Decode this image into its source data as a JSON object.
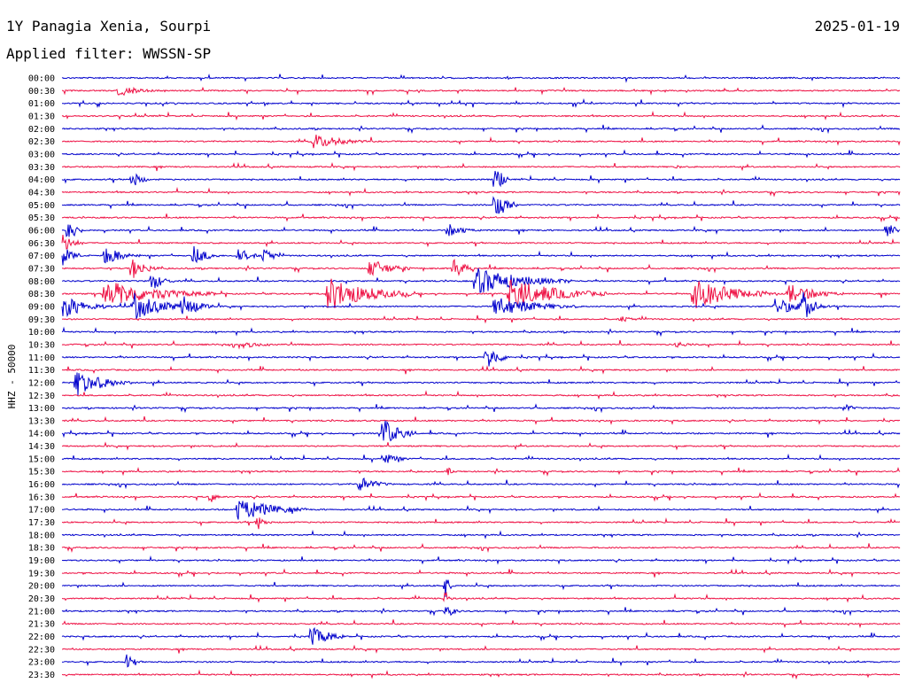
{
  "header": {
    "station": "1Y Panagia Xenia, Sourpi",
    "date": "2025-01-19",
    "filter_label": "Applied filter: WWSSN-SP"
  },
  "colors": {
    "blue": "#0000cc",
    "red": "#ee1144"
  },
  "chart_data": {
    "type": "line",
    "title": "1Y Panagia Xenia, Sourpi",
    "ylabel": "HHZ - 50000",
    "rows": [
      "00:00",
      "00:30",
      "01:00",
      "01:30",
      "02:00",
      "02:30",
      "03:00",
      "03:30",
      "04:00",
      "04:30",
      "05:00",
      "05:30",
      "06:00",
      "06:30",
      "07:00",
      "07:30",
      "08:00",
      "08:30",
      "09:00",
      "09:30",
      "10:00",
      "10:30",
      "11:00",
      "11:30",
      "12:00",
      "12:30",
      "13:00",
      "13:30",
      "14:00",
      "14:30",
      "15:00",
      "15:30",
      "16:00",
      "16:30",
      "17:00",
      "17:30",
      "18:00",
      "18:30",
      "19:00",
      "19:30",
      "20:00",
      "20:30",
      "21:00",
      "21:30",
      "22:00",
      "22:30",
      "23:00",
      "23:30"
    ],
    "series_colors": [
      "blue",
      "red"
    ],
    "minutes_per_row": 30,
    "events": [
      {
        "row": 1,
        "minute": 2,
        "amp": 7,
        "dur": 1.5
      },
      {
        "row": 5,
        "minute": 9,
        "amp": 9,
        "dur": 2
      },
      {
        "row": 7,
        "minute": 22,
        "amp": 3,
        "dur": 0.5
      },
      {
        "row": 8,
        "minute": 2.5,
        "amp": 10,
        "dur": 0.7
      },
      {
        "row": 8,
        "minute": 15.5,
        "amp": 26,
        "dur": 0.4
      },
      {
        "row": 10,
        "minute": 15.5,
        "amp": 20,
        "dur": 0.8
      },
      {
        "row": 12,
        "minute": 0.2,
        "amp": 20,
        "dur": 0.5
      },
      {
        "row": 12,
        "minute": 29.5,
        "amp": 12,
        "dur": 0.6
      },
      {
        "row": 12,
        "minute": 13.8,
        "amp": 8,
        "dur": 1.2
      },
      {
        "row": 13,
        "minute": 0,
        "amp": 12,
        "dur": 0.8
      },
      {
        "row": 14,
        "minute": 0,
        "amp": 13,
        "dur": 0.7
      },
      {
        "row": 14,
        "minute": 1.5,
        "amp": 12,
        "dur": 1.3
      },
      {
        "row": 14,
        "minute": 4.7,
        "amp": 12,
        "dur": 1
      },
      {
        "row": 14,
        "minute": 6.3,
        "amp": 11,
        "dur": 0.8
      },
      {
        "row": 14,
        "minute": 7.2,
        "amp": 11,
        "dur": 0.8
      },
      {
        "row": 15,
        "minute": 2.5,
        "amp": 13,
        "dur": 1
      },
      {
        "row": 15,
        "minute": 11,
        "amp": 12,
        "dur": 1.5
      },
      {
        "row": 15,
        "minute": 14,
        "amp": 14,
        "dur": 0.8
      },
      {
        "row": 16,
        "minute": 3.2,
        "amp": 12,
        "dur": 0.8
      },
      {
        "row": 16,
        "minute": 14.8,
        "amp": 16,
        "dur": 3.5
      },
      {
        "row": 17,
        "minute": 1.5,
        "amp": 16,
        "dur": 4
      },
      {
        "row": 17,
        "minute": 9.5,
        "amp": 20,
        "dur": 3
      },
      {
        "row": 17,
        "minute": 16,
        "amp": 18,
        "dur": 3.5
      },
      {
        "row": 17,
        "minute": 22.6,
        "amp": 18,
        "dur": 3
      },
      {
        "row": 17,
        "minute": 26,
        "amp": 12,
        "dur": 2
      },
      {
        "row": 18,
        "minute": 0,
        "amp": 14,
        "dur": 1.8
      },
      {
        "row": 18,
        "minute": 2.6,
        "amp": 16,
        "dur": 2
      },
      {
        "row": 18,
        "minute": 4.3,
        "amp": 14,
        "dur": 1.2
      },
      {
        "row": 18,
        "minute": 15.5,
        "amp": 12,
        "dur": 3
      },
      {
        "row": 18,
        "minute": 25.5,
        "amp": 10,
        "dur": 2
      },
      {
        "row": 18,
        "minute": 26.5,
        "amp": 20,
        "dur": 0.8
      },
      {
        "row": 19,
        "minute": 20,
        "amp": 4,
        "dur": 1
      },
      {
        "row": 21,
        "minute": 6.5,
        "amp": 4,
        "dur": 1.5
      },
      {
        "row": 21,
        "minute": 22,
        "amp": 4,
        "dur": 1
      },
      {
        "row": 22,
        "minute": 15.2,
        "amp": 16,
        "dur": 0.9
      },
      {
        "row": 24,
        "minute": 0.5,
        "amp": 16,
        "dur": 2
      },
      {
        "row": 26,
        "minute": 28,
        "amp": 6,
        "dur": 0.6
      },
      {
        "row": 28,
        "minute": 11.5,
        "amp": 18,
        "dur": 1.2
      },
      {
        "row": 30,
        "minute": 11.5,
        "amp": 8,
        "dur": 1
      },
      {
        "row": 31,
        "minute": 13.8,
        "amp": 6,
        "dur": 0.3
      },
      {
        "row": 32,
        "minute": 10.6,
        "amp": 10,
        "dur": 1.2
      },
      {
        "row": 33,
        "minute": 5.3,
        "amp": 8,
        "dur": 0.4
      },
      {
        "row": 34,
        "minute": 6.3,
        "amp": 14,
        "dur": 2.5
      },
      {
        "row": 35,
        "minute": 7,
        "amp": 10,
        "dur": 0.5
      },
      {
        "row": 40,
        "minute": 13.7,
        "amp": 18,
        "dur": 0.3
      },
      {
        "row": 41,
        "minute": 13.7,
        "amp": 12,
        "dur": 0.3
      },
      {
        "row": 42,
        "minute": 13.7,
        "amp": 10,
        "dur": 0.6
      },
      {
        "row": 44,
        "minute": 8.9,
        "amp": 16,
        "dur": 1.2
      },
      {
        "row": 46,
        "minute": 2.3,
        "amp": 9,
        "dur": 0.6
      }
    ]
  }
}
